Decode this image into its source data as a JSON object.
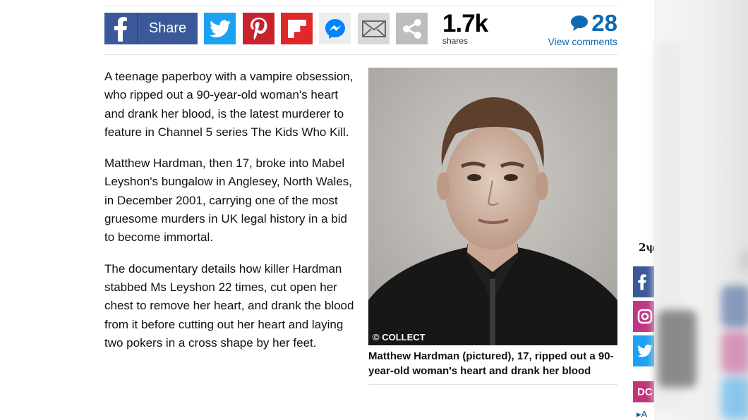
{
  "share_bar": {
    "facebook_label": "Share",
    "shares_count": "1.7k",
    "shares_label": "shares",
    "comments_count": "28",
    "comments_label": "View comments"
  },
  "article": {
    "paragraphs": [
      "A teenage paperboy with a vampire obsession, who ripped out a 90-year-old woman's heart and drank her blood, is the latest murderer to feature in Channel 5 series The Kids Who Kill.",
      "Matthew Hardman, then 17, broke into Mabel Leyshon's bungalow in Anglesey, North Wales, in December 2001, carrying one of the most gruesome murders in UK legal history in a bid to become immortal.",
      "The documentary details how killer Hardman stabbed Ms Leyshon 22 times, cut open her chest to remove her heart, and drank the blood from it before cutting out her heart and laying two pokers in a cross shape by her feet."
    ]
  },
  "photo": {
    "credit": "© COLLECT",
    "caption": "Matthew Hardman (pictured), 17, ripped out a 90-year-old woman's heart and drank her blood"
  },
  "sidebar": {
    "partial_text": "2ψ",
    "dc_label": "DC",
    "arrow_label": "▸A"
  },
  "colors": {
    "facebook": "#3b5998",
    "twitter": "#1da1f2",
    "pinterest": "#c8232c",
    "flipboard": "#e12828",
    "comments": "#0e6bb3"
  }
}
